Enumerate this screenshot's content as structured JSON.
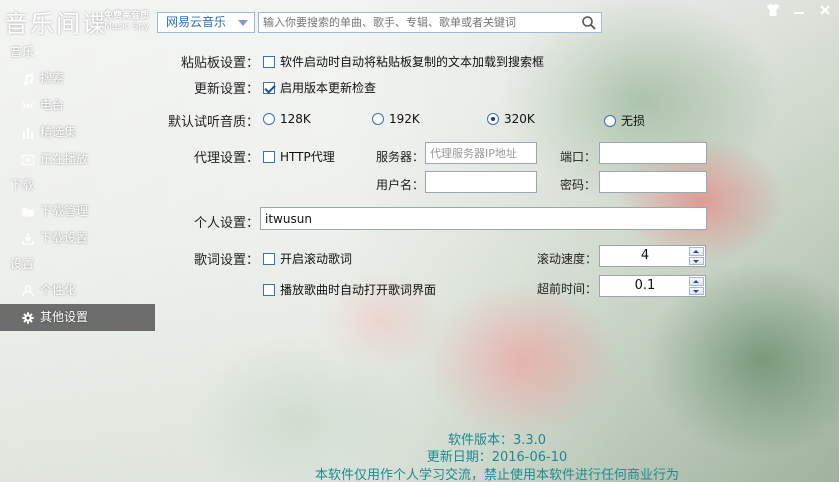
{
  "app": {
    "title": "音乐间谍",
    "subtitle_top": "免费高音质",
    "subtitle_bottom": "Music Spy"
  },
  "search": {
    "source_selected": "网易云音乐",
    "placeholder": "输入你要搜索的单曲、歌手、专辑、歌单或者关键词"
  },
  "sidebar": {
    "groups": [
      {
        "label": "音乐",
        "items": [
          {
            "label": "搜索",
            "icon": "music-note-icon"
          },
          {
            "label": "电台",
            "icon": "radio-icon"
          },
          {
            "label": "精选集",
            "icon": "bars-icon"
          },
          {
            "label": "正在播放",
            "icon": "play-box-icon"
          }
        ]
      },
      {
        "label": "下载",
        "items": [
          {
            "label": "下载管理",
            "icon": "folder-icon"
          },
          {
            "label": "下载设置",
            "icon": "download-icon"
          }
        ]
      },
      {
        "label": "设置",
        "items": [
          {
            "label": "个性化",
            "icon": "user-icon"
          },
          {
            "label": "其他设置",
            "icon": "gear-icon",
            "active": true
          }
        ]
      }
    ]
  },
  "settings": {
    "clipboard": {
      "label": "粘贴板设置：",
      "option": "软件启动时自动将粘贴板复制的文本加载到搜索框",
      "checked": false
    },
    "update": {
      "label": "更新设置：",
      "option": "启用版本更新检查",
      "checked": true
    },
    "quality": {
      "label": "默认试听音质：",
      "options": [
        "128K",
        "192K",
        "320K",
        "无损"
      ],
      "selected": "320K"
    },
    "proxy": {
      "label": "代理设置：",
      "http_label": "HTTP代理",
      "http_checked": false,
      "server_label": "服务器：",
      "server_placeholder": "代理服务器IP地址",
      "port_label": "端口：",
      "port_value": "",
      "username_label": "用户名：",
      "username_value": "",
      "password_label": "密码：",
      "password_value": ""
    },
    "personal": {
      "label": "个人设置：",
      "value": "itwusun"
    },
    "lyrics": {
      "label": "歌词设置：",
      "scroll_option": "开启滚动歌词",
      "scroll_checked": false,
      "auto_open_option": "播放歌曲时自动打开歌词界面",
      "auto_open_checked": false,
      "speed_label": "滚动速度：",
      "speed_value": "4",
      "advance_label": "超前时间：",
      "advance_value": "0.1"
    }
  },
  "footer": {
    "version": "软件版本：3.3.0",
    "updated": "更新日期：2016-06-10",
    "notice": "本软件仅用作个人学习交流，禁止使用本软件进行任何商业行为"
  },
  "colors": {
    "accent": "#2c6fb5",
    "footer_text": "#1d8a92",
    "sidebar_active": "#3c3c3c"
  }
}
